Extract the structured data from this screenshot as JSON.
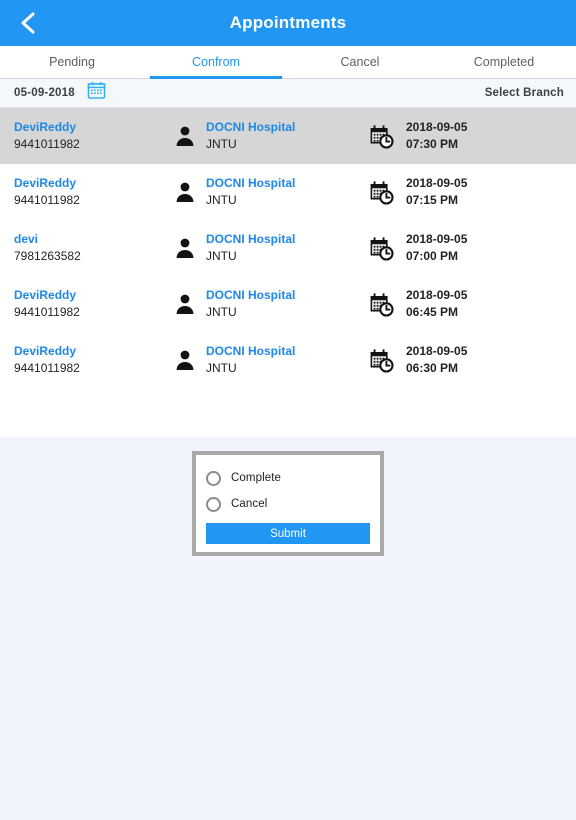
{
  "appbar": {
    "title": "Appointments",
    "back_icon": "chevron-left-icon",
    "bg_color": "#2196f3"
  },
  "tabs": [
    {
      "label": "Pending",
      "active": false
    },
    {
      "label": "Confrom",
      "active": true
    },
    {
      "label": "Cancel",
      "active": false
    },
    {
      "label": "Completed",
      "active": false
    }
  ],
  "filterbar": {
    "date": "05-09-2018",
    "calendar_icon": "calendar-icon",
    "branch_label": "Select Branch"
  },
  "list": {
    "person_icon": "person-icon",
    "datetime_icon": "calendar-clock-icon",
    "rows": [
      {
        "patient_name": "DeviReddy",
        "phone": "9441011982",
        "hospital": "DOCNI Hospital",
        "branch": "JNTU",
        "date": "2018-09-05",
        "time": "07:30 PM",
        "selected": true
      },
      {
        "patient_name": "DeviReddy",
        "phone": "9441011982",
        "hospital": "DOCNI Hospital",
        "branch": "JNTU",
        "date": "2018-09-05",
        "time": "07:15 PM",
        "selected": false
      },
      {
        "patient_name": "devi",
        "phone": "7981263582",
        "hospital": "DOCNI Hospital",
        "branch": "JNTU",
        "date": "2018-09-05",
        "time": "07:00 PM",
        "selected": false
      },
      {
        "patient_name": "DeviReddy",
        "phone": "9441011982",
        "hospital": "DOCNI Hospital",
        "branch": "JNTU",
        "date": "2018-09-05",
        "time": "06:45 PM",
        "selected": false
      },
      {
        "patient_name": "DeviReddy",
        "phone": "9441011982",
        "hospital": "DOCNI Hospital",
        "branch": "JNTU",
        "date": "2018-09-05",
        "time": "06:30 PM",
        "selected": false
      }
    ]
  },
  "dialog": {
    "options": [
      {
        "label": "Complete",
        "checked": false
      },
      {
        "label": "Cancel",
        "checked": false
      }
    ],
    "submit_label": "Submit"
  },
  "colors": {
    "accent": "#2196f3",
    "link": "#1e88e5",
    "selected_row": "#d6d6d6",
    "page_bg": "#f1f5fb",
    "filter_bg": "#f4f7fb",
    "dialog_border": "#a9a9a9"
  }
}
